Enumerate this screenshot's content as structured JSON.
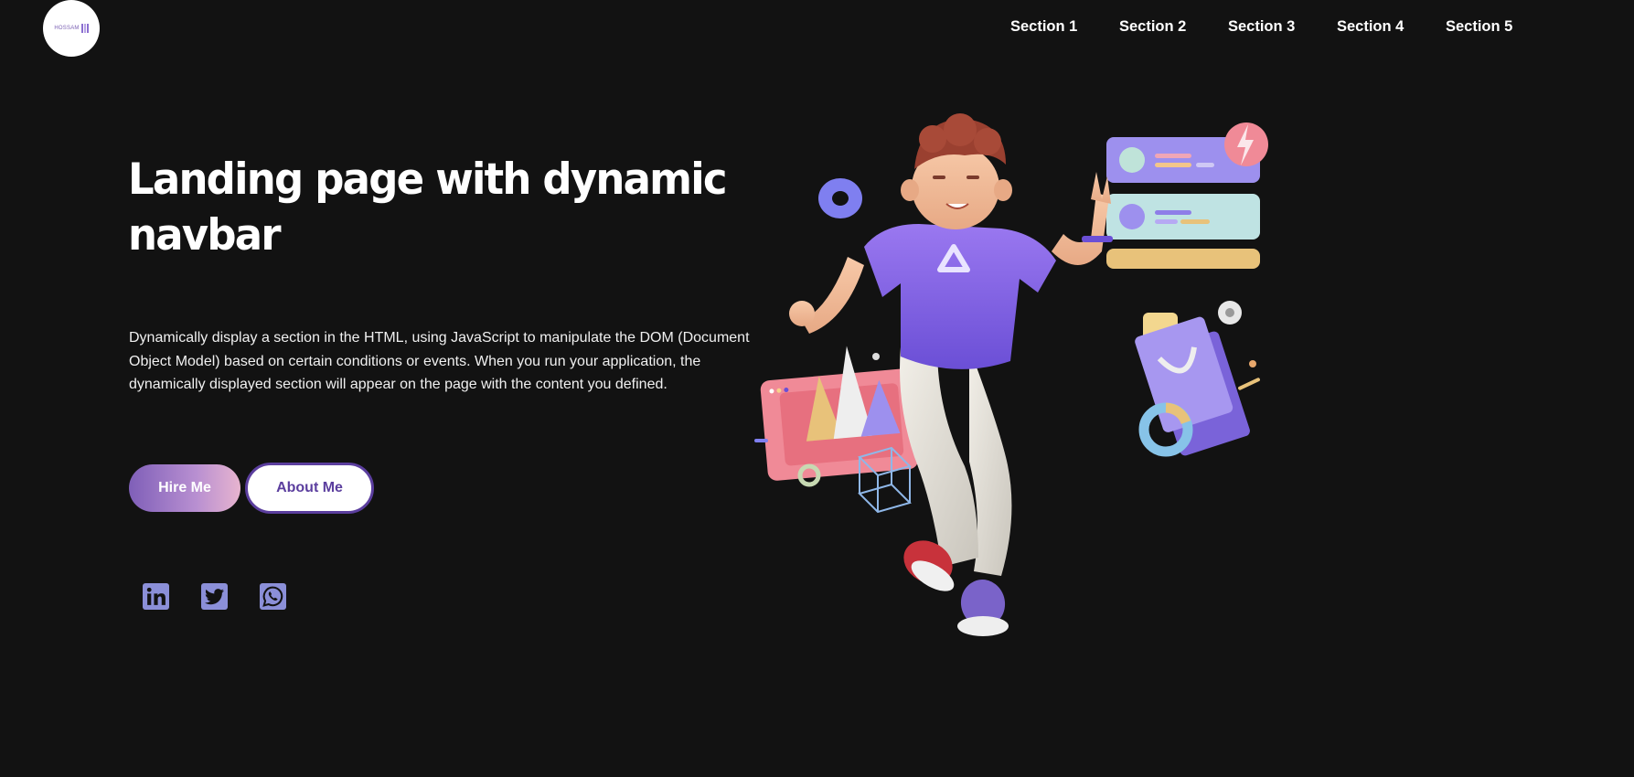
{
  "logo": {
    "text": "HOSSAM"
  },
  "nav": {
    "items": [
      {
        "label": "Section 1"
      },
      {
        "label": "Section 2"
      },
      {
        "label": "Section 3"
      },
      {
        "label": "Section 4"
      },
      {
        "label": "Section 5"
      }
    ]
  },
  "hero": {
    "title": "Landing page with dynamic navbar",
    "description": "Dynamically display a section in the HTML, using JavaScript to manipulate the DOM (Document Object Model) based on certain conditions or events. When you run your application, the dynamically displayed section will appear on the page with the content you defined.",
    "hire_label": "Hire Me",
    "about_label": "About Me"
  },
  "socials": [
    {
      "icon": "linkedin-icon"
    },
    {
      "icon": "twitter-icon"
    },
    {
      "icon": "whatsapp-icon"
    }
  ],
  "colors": {
    "background": "#121212",
    "accent": "#5b3e9e",
    "social": "#8b8fd8"
  }
}
